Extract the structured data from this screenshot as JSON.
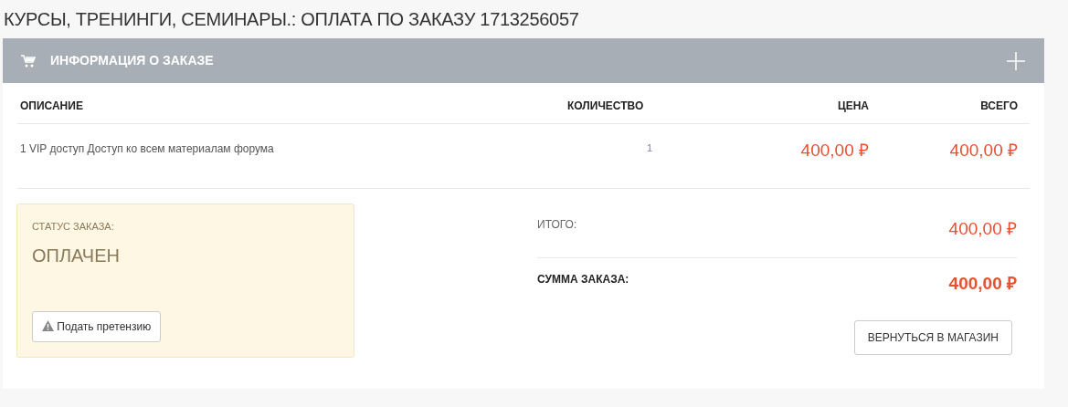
{
  "page_title": "КУРСЫ, ТРЕНИНГИ, СЕМИНАРЫ.: ОПЛАТА ПО ЗАКАЗУ 1713256057",
  "panel": {
    "title": "ИНФОРМАЦИЯ О ЗАКАЗЕ",
    "expanded": false
  },
  "table": {
    "columns": [
      "ОПИСАНИЕ",
      "КОЛИЧЕСТВО",
      "ЦЕНА",
      "ВСЕГО"
    ],
    "rows": [
      {
        "description": "1 VIP доступ Доступ ко всем материалам форума",
        "quantity": "1",
        "price": "400,00 ₽",
        "total": "400,00 ₽"
      }
    ]
  },
  "status": {
    "label": "СТАТУС ЗАКАЗА:",
    "value": "ОПЛАЧЕН",
    "button": "Подать претензию"
  },
  "summary": [
    {
      "label": "ИТОГО:",
      "value": "400,00 ₽",
      "kind": "subtotal"
    },
    {
      "label": "СУММА ЗАКАЗА:",
      "value": "400,00 ₽",
      "kind": "total"
    }
  ],
  "back_button": "ВЕРНУТЬСЯ В МАГАЗИН"
}
